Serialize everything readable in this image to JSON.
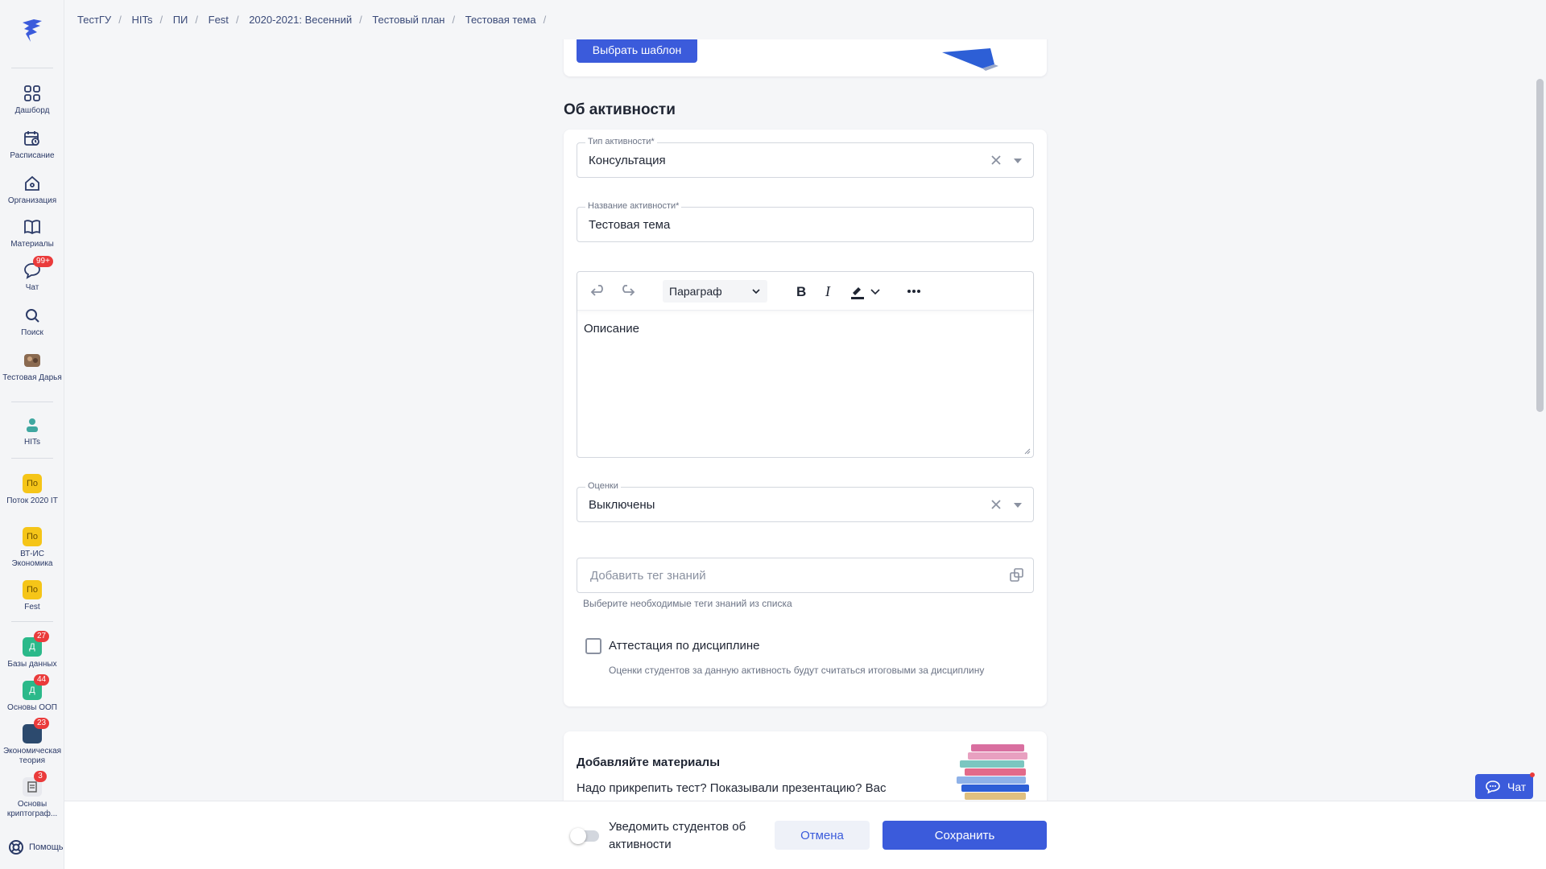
{
  "breadcrumbs": [
    "ТестГУ",
    "HITs",
    "ПИ",
    "Fest",
    "2020-2021: Весенний",
    "Тестовый план",
    "Тестовая тема"
  ],
  "sidebar": {
    "items": [
      {
        "label": "Дашборд",
        "icon": "dashboard-icon"
      },
      {
        "label": "Расписание",
        "icon": "calendar-icon"
      },
      {
        "label": "Организация",
        "icon": "home-icon"
      },
      {
        "label": "Материалы",
        "icon": "book-icon"
      },
      {
        "label": "Чат",
        "icon": "chat-icon",
        "badge": "99+"
      },
      {
        "label": "Поиск",
        "icon": "search-icon"
      },
      {
        "label": "Тестовая Дарья",
        "icon": "avatar-icon"
      }
    ],
    "org": {
      "label": "HITs"
    },
    "streams": [
      {
        "letter": "По",
        "label": "Поток 2020 IT"
      },
      {
        "letter": "По",
        "label": "ВТ-ИС Экономика"
      },
      {
        "letter": "По",
        "label": "Fest"
      }
    ],
    "courses": [
      {
        "letter": "Д",
        "label": "Базы данных",
        "badge": "27"
      },
      {
        "letter": "Д",
        "label": "Основы ООП",
        "badge": "44"
      },
      {
        "letter": "",
        "label": "Экономическая теория",
        "badge": "23"
      },
      {
        "letter": "",
        "label": "Основы криптограф...",
        "badge": "3"
      }
    ],
    "help_label": "Помощь"
  },
  "template_card": {
    "button_label": "Выбрать шаблон"
  },
  "about": {
    "title": "Об активности",
    "activity_type": {
      "label": "Тип активности*",
      "value": "Консультация"
    },
    "activity_name": {
      "label": "Название активности*",
      "value": "Тестовая тема"
    },
    "editor": {
      "paragraph_label": "Параграф",
      "body": "Описание"
    },
    "grades": {
      "label": "Оценки",
      "value": "Выключены"
    },
    "tags": {
      "placeholder": "Добавить тег знаний",
      "hint": "Выберите необходимые теги знаний из списка"
    },
    "attestation": {
      "label": "Аттестация по дисциплине",
      "description": "Оценки студентов за данную активность будут считаться итоговыми за дисциплину",
      "checked": false
    }
  },
  "materials_card": {
    "title": "Добавляйте материалы",
    "text": "Надо прикрепить тест? Показывали презентацию? Вас"
  },
  "bottom": {
    "notify_label": "Уведомить студентов об активности",
    "notify_on": false,
    "cancel_label": "Отмена",
    "save_label": "Сохранить"
  },
  "chat_fab": {
    "label": "Чат"
  },
  "colors": {
    "accent": "#3b5bdb",
    "badge": "#ea3b3b",
    "yellow": "#f5c518",
    "green": "#2bb98a"
  }
}
